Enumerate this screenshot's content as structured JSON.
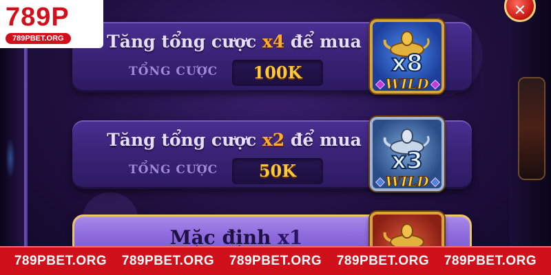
{
  "brand": {
    "logo_text": "789P",
    "logo_url": "789PBET.ORG",
    "red": "#d0111b"
  },
  "close_button": {
    "icon": "close-icon",
    "glyph": "✕"
  },
  "options": [
    {
      "title_prefix": "Tăng tổng cược ",
      "multiplier": "x4",
      "title_suffix": " để mua",
      "bet_label": "TỔNG CƯỢC",
      "bet_value": "100K",
      "wild_multiplier": "x8",
      "wild_label": "WILD"
    },
    {
      "title_prefix": "Tăng tổng cược ",
      "multiplier": "x2",
      "title_suffix": " để mua",
      "bet_label": "TỔNG CƯỢC",
      "bet_value": "50K",
      "wild_multiplier": "x3",
      "wild_label": "WILD"
    },
    {
      "title_prefix": "Mặc định ",
      "multiplier": "x1"
    }
  ],
  "footer": {
    "items": [
      "789PBET.ORG",
      "789PBET.ORG",
      "789PBET.ORG",
      "789PBET.ORG",
      "789PBET.ORG"
    ]
  },
  "colors": {
    "multiplier": "#ffae2a",
    "bet_value": "#ffc933",
    "panel": "#3a2478",
    "selected_panel": "#8f6cde"
  }
}
